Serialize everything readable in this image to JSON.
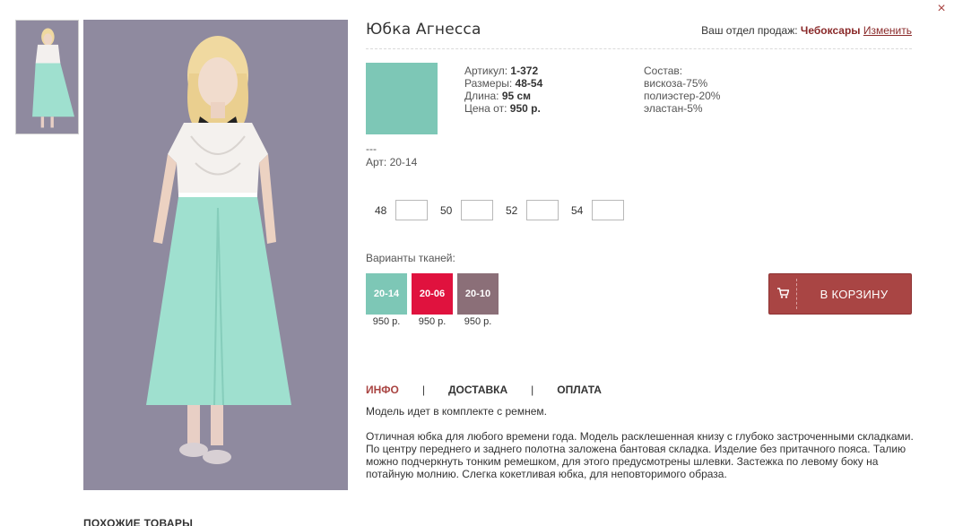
{
  "close": {
    "glyph": "×"
  },
  "product": {
    "title": "Юбка Агнесса",
    "color_hex": "#7dc7b6"
  },
  "department": {
    "label": "Ваш отдел продаж:",
    "city": "Чебоксары",
    "change": "Изменить"
  },
  "specs": {
    "article_label": "Артикул:",
    "article_value": "1-372",
    "sizes_label": "Размеры:",
    "sizes_value": "48-54",
    "length_label": "Длина:",
    "length_value": "95 см",
    "price_label": "Цена от:",
    "price_value": "950 р."
  },
  "composition": {
    "title": "Состав:",
    "items": [
      "вискоза-75%",
      "полиэстер-20%",
      "эластан-5%"
    ]
  },
  "dashes": "---",
  "art_text": "Арт: 20-14",
  "sizes": [
    {
      "label": "48",
      "value": ""
    },
    {
      "label": "50",
      "value": ""
    },
    {
      "label": "52",
      "value": ""
    },
    {
      "label": "54",
      "value": ""
    }
  ],
  "fabrics": {
    "title": "Варианты тканей:",
    "items": [
      {
        "code": "20-14",
        "price": "950 р.",
        "color": "#7dc7b6"
      },
      {
        "code": "20-06",
        "price": "950 р.",
        "color": "#e0123e"
      },
      {
        "code": "20-10",
        "price": "950 р.",
        "color": "#8b6f78"
      }
    ]
  },
  "cart": {
    "label": "В КОРЗИНУ",
    "icon": "cart-icon"
  },
  "tabs": [
    {
      "label": "ИНФО",
      "active": true
    },
    {
      "label": "ДОСТАВКА",
      "active": false
    },
    {
      "label": "ОПЛАТА",
      "active": false
    }
  ],
  "tab_separator": "|",
  "description": {
    "line1": "Модель идет в комплекте с ремнем.",
    "line2": "Отличная юбка для любого времени года. Модель расклешенная книзу с глубоко застроченными складками. По центру переднего и заднего полотна заложена бантовая складка. Изделие без притачного пояса. Талию можно подчеркнуть тонким ремешком, для этого предусмотрены шлевки. Застежка по левому боку на потайную молнию. Слегка кокетливая юбка, для неповторимого образа."
  },
  "related_title": "ПОХОЖИЕ ТОВАРЫ",
  "colors": {
    "accent": "#a94442",
    "button": "#a94544",
    "photo_background": "#8f8a9f"
  }
}
